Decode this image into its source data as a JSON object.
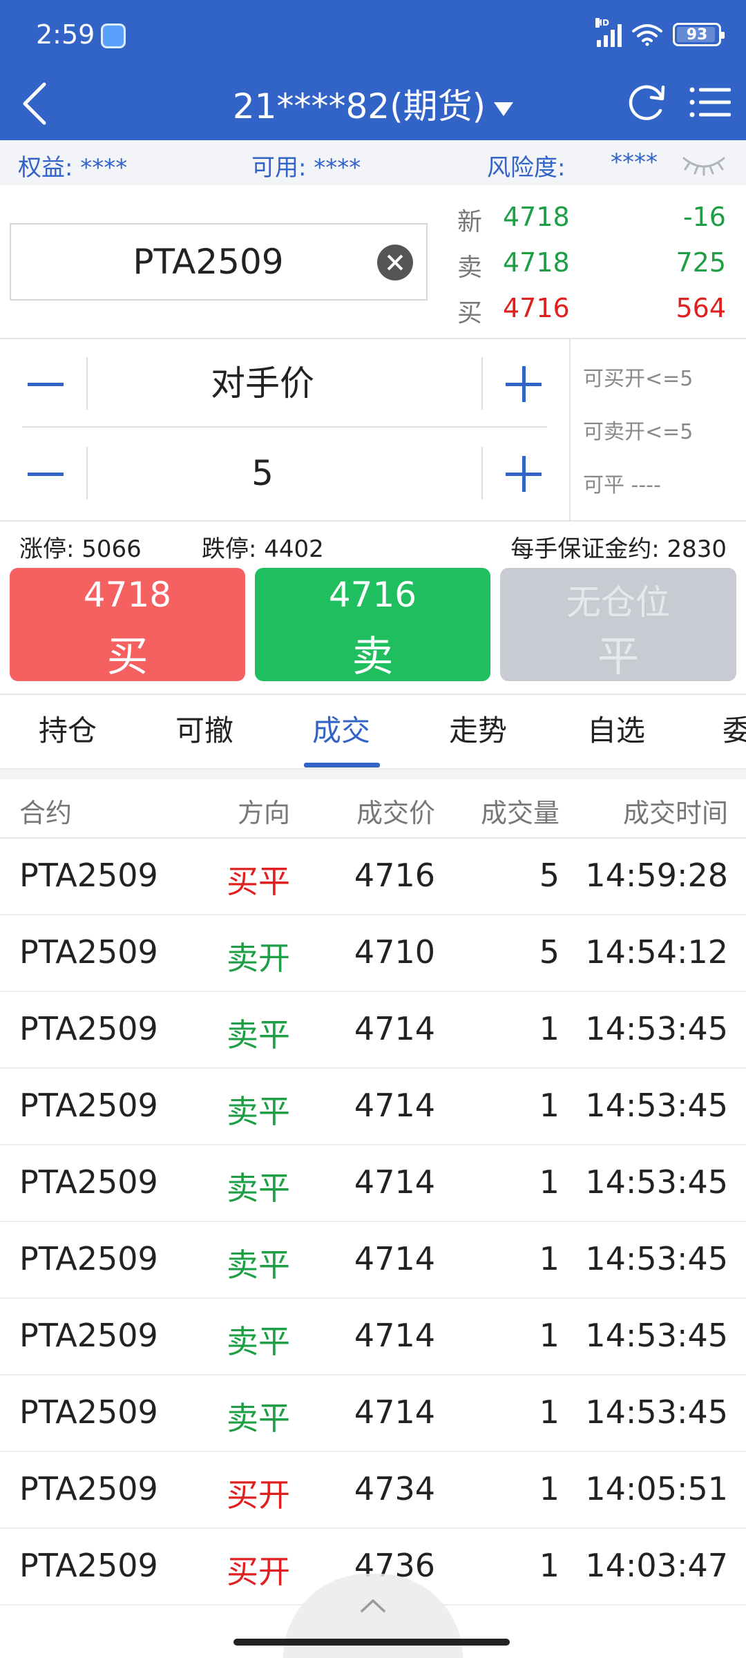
{
  "status_bar": {
    "time": "2:59",
    "network": "HD",
    "battery": "93"
  },
  "nav": {
    "title": "21****82(期货)",
    "icons": [
      "back-icon",
      "refresh-icon",
      "menu-icon"
    ]
  },
  "account": {
    "equity": "权益: ****",
    "available": "可用: ****",
    "risk_label": "风险度:",
    "risk_value": "****"
  },
  "symbol_input": {
    "value": "PTA2509"
  },
  "quote": {
    "new": {
      "label": "新",
      "price": "4718",
      "value": "-16"
    },
    "sell": {
      "label": "卖",
      "price": "4718",
      "value": "725"
    },
    "buy": {
      "label": "买",
      "price": "4716",
      "value": "564"
    }
  },
  "order": {
    "price_type": "对手价",
    "quantity": "5",
    "can_buy_open": "可买开<=5",
    "can_sell_open": "可卖开<=5",
    "can_close": "可平 ----"
  },
  "limits": {
    "limit_up": "涨停: 5066",
    "limit_down": "跌停: 4402",
    "margin": "每手保证金约: 2830"
  },
  "buttons": {
    "buy": {
      "price": "4718",
      "label": "买"
    },
    "sell": {
      "price": "4716",
      "label": "卖"
    },
    "close": {
      "price": "无仓位",
      "label": "平"
    }
  },
  "tabs": [
    "持仓",
    "可撤",
    "成交",
    "走势",
    "自选",
    "委"
  ],
  "active_tab": "成交",
  "table": {
    "headers": [
      "合约",
      "方向",
      "成交价",
      "成交量",
      "成交时间"
    ],
    "rows": [
      {
        "contract": "PTA2509",
        "direction": "买平",
        "price": "4716",
        "volume": "5",
        "time": "14:59:28",
        "side": "buy"
      },
      {
        "contract": "PTA2509",
        "direction": "卖开",
        "price": "4710",
        "volume": "5",
        "time": "14:54:12",
        "side": "sell"
      },
      {
        "contract": "PTA2509",
        "direction": "卖平",
        "price": "4714",
        "volume": "1",
        "time": "14:53:45",
        "side": "sell"
      },
      {
        "contract": "PTA2509",
        "direction": "卖平",
        "price": "4714",
        "volume": "1",
        "time": "14:53:45",
        "side": "sell"
      },
      {
        "contract": "PTA2509",
        "direction": "卖平",
        "price": "4714",
        "volume": "1",
        "time": "14:53:45",
        "side": "sell"
      },
      {
        "contract": "PTA2509",
        "direction": "卖平",
        "price": "4714",
        "volume": "1",
        "time": "14:53:45",
        "side": "sell"
      },
      {
        "contract": "PTA2509",
        "direction": "卖平",
        "price": "4714",
        "volume": "1",
        "time": "14:53:45",
        "side": "sell"
      },
      {
        "contract": "PTA2509",
        "direction": "卖平",
        "price": "4714",
        "volume": "1",
        "time": "14:53:45",
        "side": "sell"
      },
      {
        "contract": "PTA2509",
        "direction": "买开",
        "price": "4734",
        "volume": "1",
        "time": "14:05:51",
        "side": "buy"
      },
      {
        "contract": "PTA2509",
        "direction": "买开",
        "price": "4736",
        "volume": "1",
        "time": "14:03:47",
        "side": "buy"
      }
    ]
  },
  "colors": {
    "brand": "#3264c8",
    "buy": "#e02020",
    "sell": "#1e9e45",
    "buy_button": "#f56060",
    "sell_button": "#1fbf5f",
    "disabled_button": "#c8ccd2"
  }
}
